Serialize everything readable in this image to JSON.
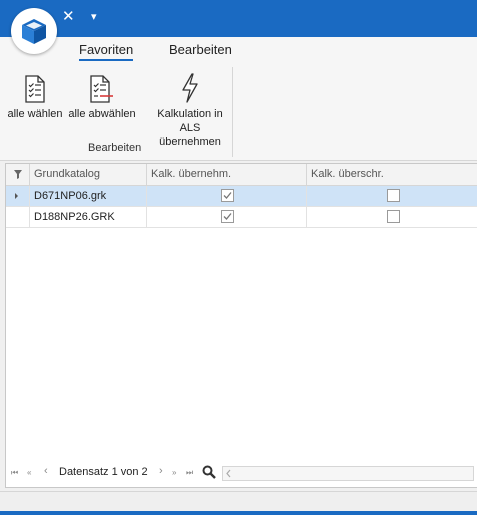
{
  "window": {
    "close_glyph": "✕",
    "menu_glyph": "▾",
    "accent": "#1a6ac2",
    "logo_icon": "cube-icon"
  },
  "tabs": [
    {
      "label": "Favoriten",
      "active": true
    },
    {
      "label": "Bearbeiten",
      "active": false
    }
  ],
  "ribbon": {
    "buttons": [
      {
        "label": "alle wählen",
        "icon": "checklist-icon"
      },
      {
        "label": "alle abwählen",
        "icon": "checklist-uncheck-icon"
      },
      {
        "label_line1": "Kalkulation in",
        "label_line2": "ALS übernehmen",
        "icon": "lightning-icon"
      }
    ],
    "group_label": "Bearbeiten"
  },
  "grid": {
    "columns": [
      "Grundkatalog",
      "Kalk. übernehm.",
      "Kalk. überschr."
    ],
    "rows": [
      {
        "grundkatalog": "D671NP06.grk",
        "kalk_uebernehm": true,
        "kalk_ueberschr": false,
        "selected": true
      },
      {
        "grundkatalog": "D188NP26.GRK",
        "kalk_uebernehm": true,
        "kalk_ueberschr": false,
        "selected": false
      }
    ],
    "selected_row_color": "#cfe3f7"
  },
  "navigator": {
    "text": "Datensatz 1 von 2",
    "first": "⏮",
    "prev_page": "«",
    "prev": "‹",
    "next": "›",
    "next_page": "»",
    "last": "⏭"
  }
}
